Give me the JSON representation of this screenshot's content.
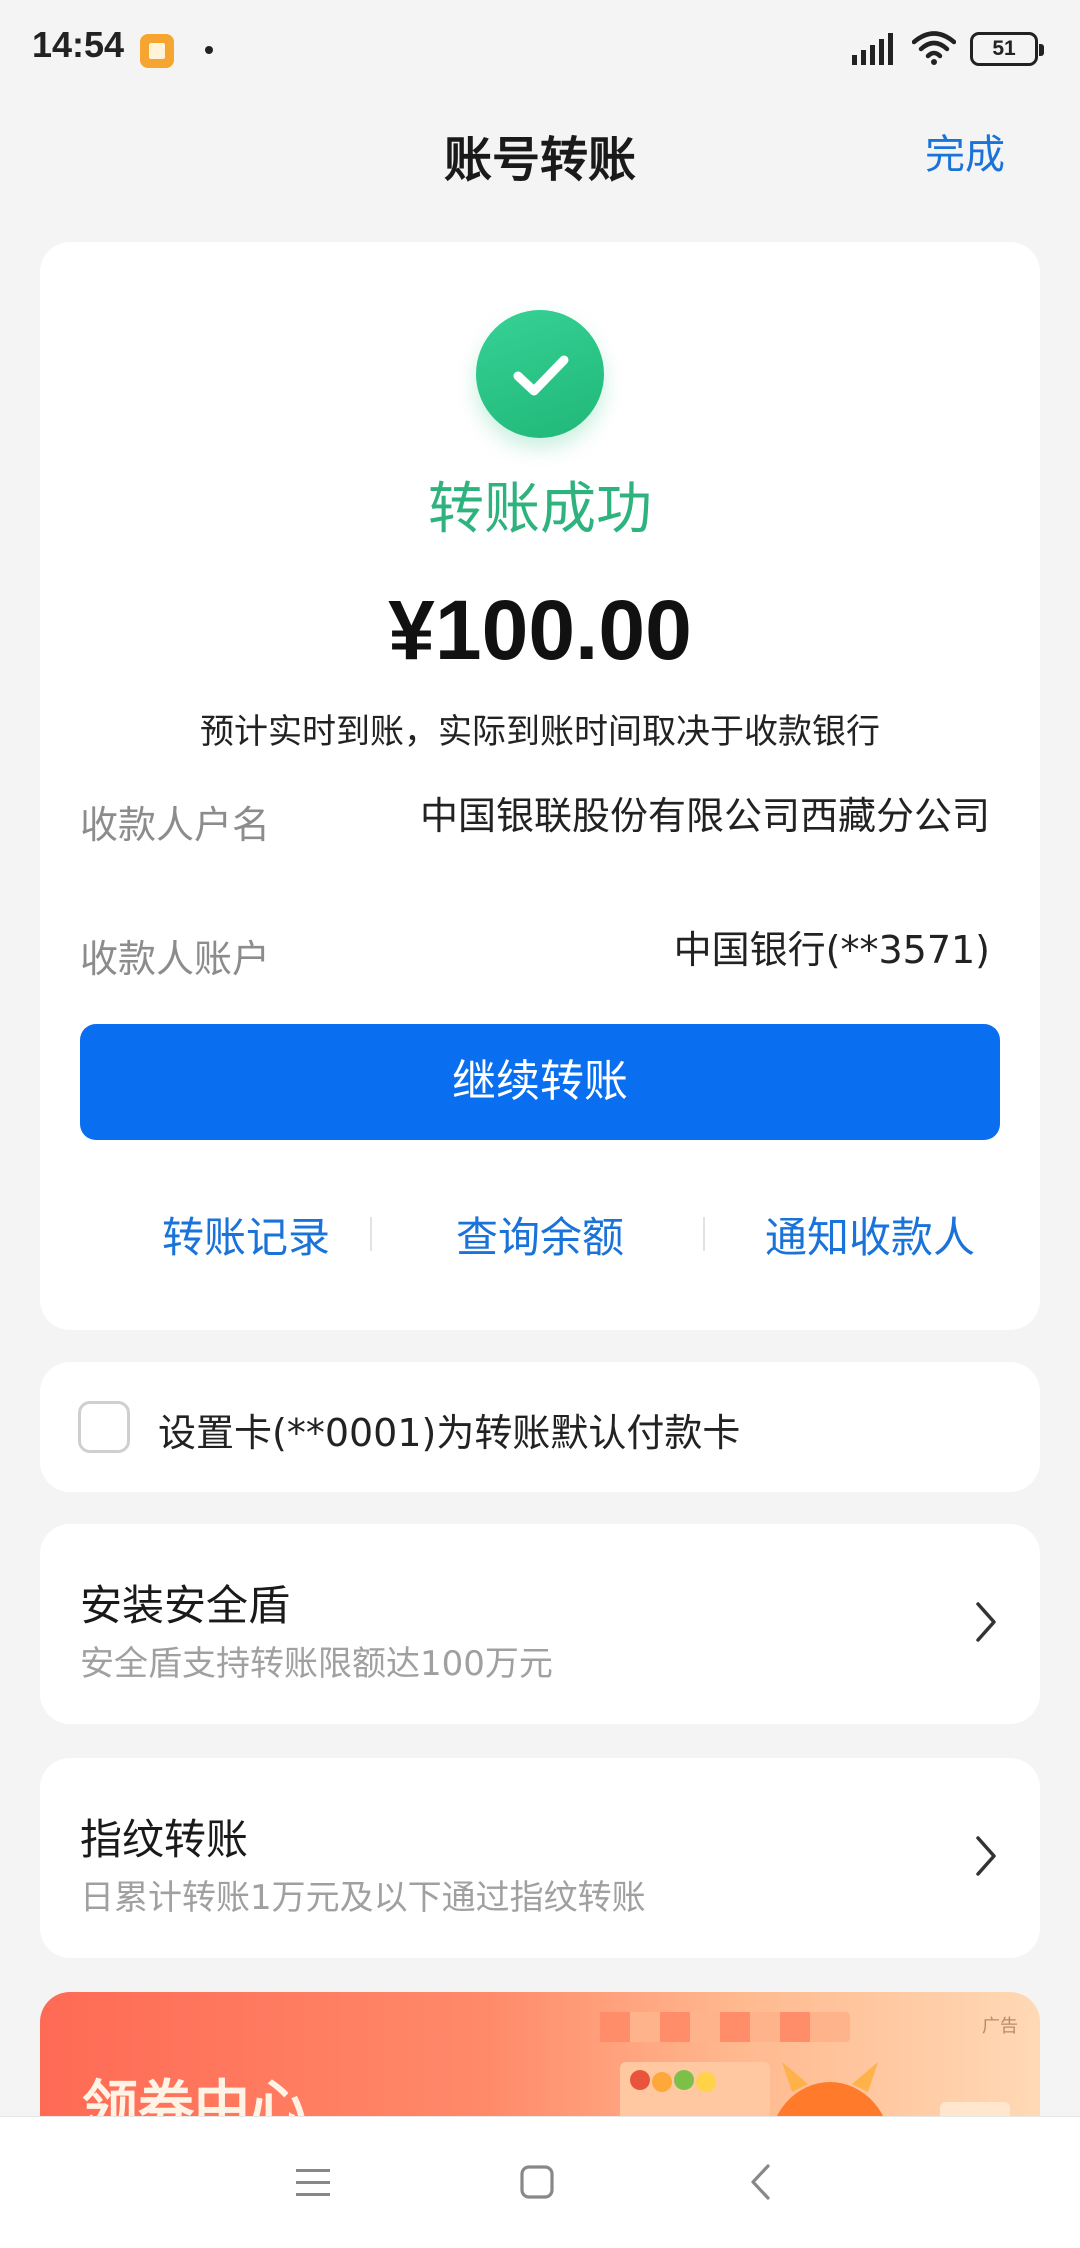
{
  "status_bar": {
    "time": "14:54",
    "battery": "51",
    "icons": [
      "app-notification-icon",
      "signal-icon",
      "wifi-icon",
      "battery-icon"
    ]
  },
  "header": {
    "title": "账号转账",
    "done_label": "完成"
  },
  "result": {
    "status_text": "转账成功",
    "amount": "¥100.00",
    "arrival_note": "预计实时到账，实际到账时间取决于收款银行",
    "payee_name_label": "收款人户名",
    "payee_name_value": "中国银联股份有限公司西藏分公司",
    "payee_account_label": "收款人账户",
    "payee_account_value": "中国银行(**3571)",
    "continue_label": "继续转账",
    "links": {
      "records": "转账记录",
      "balance": "查询余额",
      "notify": "通知收款人"
    }
  },
  "default_card": {
    "text": "设置卡(**0001)为转账默认付款卡",
    "checked": false
  },
  "features": {
    "shield": {
      "title": "安装安全盾",
      "subtitle": "安全盾支持转账限额达100万元"
    },
    "fingerprint": {
      "title": "指纹转账",
      "subtitle": "日累计转账1万元及以下通过指纹转账"
    }
  },
  "banner": {
    "title": "领券中心",
    "ad_tag": "广告"
  },
  "colors": {
    "accent_blue": "#0a6ef0",
    "link_blue": "#1a73d9",
    "success_green": "#2eb37f",
    "background": "#f4f4f4"
  }
}
